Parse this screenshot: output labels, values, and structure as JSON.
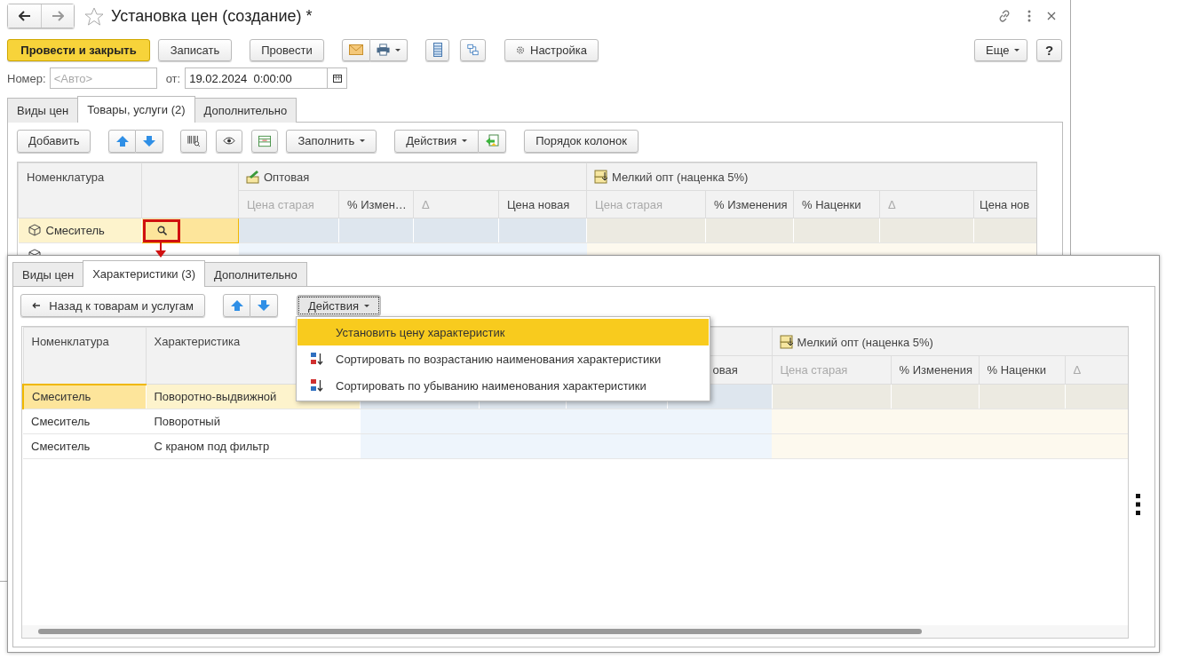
{
  "window": {
    "title": "Установка цен (создание) *"
  },
  "command_bar": {
    "buttons": [
      {
        "label": "Провести и закрыть",
        "kind": "primary"
      },
      {
        "label": "Записать",
        "kind": "plain"
      },
      {
        "label": "Провести",
        "kind": "plain"
      }
    ],
    "settings_label": "Настройка",
    "more_label": "Еще",
    "help_label": "?"
  },
  "header_fields": {
    "number": {
      "label": "Номер:",
      "placeholder": "<Авто>"
    },
    "date": {
      "label": "от:",
      "value": "19.02.2024  0:00:00"
    }
  },
  "tabs": [
    {
      "label": "Виды цен",
      "selected": false
    },
    {
      "label": "Товары, услуги (2)",
      "selected": true
    },
    {
      "label": "Дополнительно",
      "selected": false
    }
  ],
  "items_toolbar": {
    "add": "Добавить",
    "fill": "Заполнить",
    "actions": "Действия",
    "column_order": "Порядок колонок"
  },
  "items_table": {
    "first_column": "Номенклатура",
    "groups": [
      {
        "title": "Оптовая",
        "color": "#eef5fc",
        "columns": [
          {
            "label": "Цена старая",
            "muted": true
          },
          {
            "label": "% Измен…",
            "muted": false
          },
          {
            "label": "Δ",
            "muted": true
          },
          {
            "label": "Цена новая",
            "muted": false
          }
        ]
      },
      {
        "title": "Мелкий опт (наценка 5%)",
        "color": "#fdf9ee",
        "columns": [
          {
            "label": "Цена старая",
            "muted": true
          },
          {
            "label": "% Изменения",
            "muted": false
          },
          {
            "label": "% Наценки",
            "muted": false
          },
          {
            "label": "Δ",
            "muted": true
          },
          {
            "label": "Цена нов",
            "muted": false
          }
        ]
      }
    ],
    "rows": [
      {
        "name": "Смеситель",
        "selected": true
      },
      {
        "selected": false
      }
    ]
  },
  "characteristics_form": {
    "tabs": [
      {
        "label": "Виды цен",
        "selected": false
      },
      {
        "label": "Характеристики (3)",
        "selected": true
      },
      {
        "label": "Дополнительно",
        "selected": false
      }
    ],
    "back_button": "Назад к товарам и услугам",
    "actions_button": {
      "label": "Действия",
      "pressed": true
    },
    "actions_menu": [
      {
        "label": "Установить цену характеристик",
        "kind": "plain",
        "highlighted": true
      },
      {
        "label": "Сортировать по возрастанию наименования характеристики",
        "kind": "sort-asc",
        "highlighted": false
      },
      {
        "label": "Сортировать по убыванию наименования характеристики",
        "kind": "sort-desc",
        "highlighted": false
      }
    ],
    "table": {
      "columns": [
        "Номенклатура",
        "Характеристика"
      ],
      "groups": [
        {
          "color": "#eef5fc",
          "columns": [
            {
              "label": "овая"
            }
          ]
        },
        {
          "title": "Мелкий опт (наценка 5%)",
          "color": "#fdf9ee",
          "columns": [
            {
              "label": "Цена старая",
              "muted": true
            },
            {
              "label": "% Изменения",
              "muted": false
            },
            {
              "label": "% Наценки",
              "muted": false
            },
            {
              "label": "Δ",
              "muted": true
            }
          ]
        }
      ],
      "rows": [
        {
          "item": "Смеситель",
          "characteristic": "Поворотно-выдвижной",
          "selected": true
        },
        {
          "item": "Смеситель",
          "characteristic": "Поворотный",
          "selected": false
        },
        {
          "item": "Смеситель",
          "characteristic": "С краном под фильтр",
          "selected": false
        }
      ]
    }
  }
}
